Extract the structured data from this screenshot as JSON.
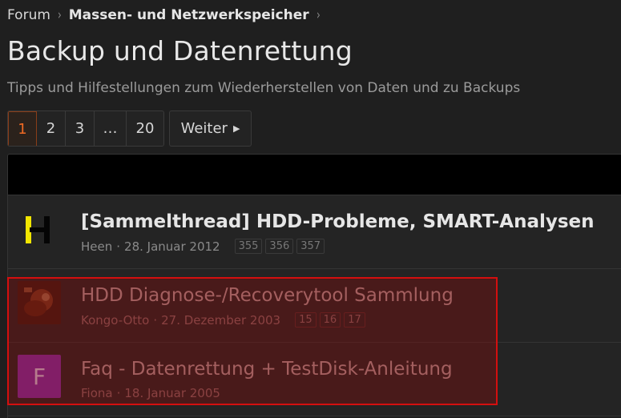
{
  "breadcrumb": {
    "items": [
      "Forum",
      "Massen- und Netzwerkspeicher"
    ],
    "separator": "›"
  },
  "page": {
    "title": "Backup und Datenrettung",
    "description": "Tipps und Hilfestellungen zum Wiederherstellen von Daten und zu Backups"
  },
  "pagination": {
    "pages": [
      "1",
      "2",
      "3",
      "…",
      "20"
    ],
    "current": "1",
    "next_label": "Weiter",
    "next_icon": "triangle-right-icon"
  },
  "threads": [
    {
      "title": "[Sammelthread] HDD-Probleme, SMART-Analysen",
      "author": "Heen",
      "date": "28. Januar 2012",
      "pages": [
        "355",
        "356",
        "357"
      ],
      "avatar": "H-logo-avatar"
    },
    {
      "title": "HDD Diagnose-/Recoverytool Sammlung",
      "author": "Kongo-Otto",
      "date": "27. Dezember 2003",
      "pages": [
        "15",
        "16",
        "17"
      ],
      "avatar": "photo-avatar"
    },
    {
      "title": "Faq - Datenrettung + TestDisk-Anleitung",
      "author": "Fiona",
      "date": "18. Januar 2005",
      "pages": [],
      "avatar_letter": "F",
      "avatar_color": "#8a2bb0"
    }
  ],
  "colors": {
    "accent": "#f06a24",
    "highlight_border": "#d40f0f"
  }
}
